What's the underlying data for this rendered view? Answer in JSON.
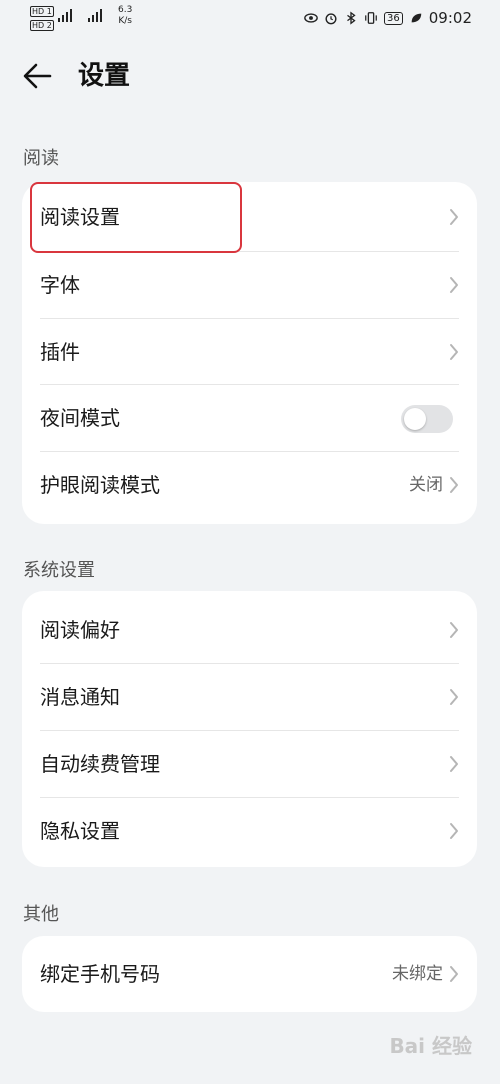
{
  "status": {
    "sim1": "HD 1",
    "sim2": "HD 2",
    "net_speed": "6.3",
    "net_unit": "K/s",
    "battery": "36",
    "time": "09:02",
    "icons": [
      "eye-icon",
      "alarm-icon",
      "bluetooth-icon",
      "vibrate-icon",
      "battery-icon",
      "leaf-icon"
    ]
  },
  "header": {
    "title": "设置",
    "back_icon": "back-arrow-icon"
  },
  "sections": {
    "reading": {
      "label": "阅读",
      "items": [
        {
          "label": "阅读设置",
          "type": "chevron"
        },
        {
          "label": "字体",
          "type": "chevron"
        },
        {
          "label": "插件",
          "type": "chevron"
        },
        {
          "label": "夜间模式",
          "type": "toggle",
          "on": false
        },
        {
          "label": "护眼阅读模式",
          "type": "chevron",
          "value": "关闭"
        }
      ]
    },
    "system": {
      "label": "系统设置",
      "items": [
        {
          "label": "阅读偏好",
          "type": "chevron"
        },
        {
          "label": "消息通知",
          "type": "chevron"
        },
        {
          "label": "自动续费管理",
          "type": "chevron"
        },
        {
          "label": "隐私设置",
          "type": "chevron"
        }
      ]
    },
    "other": {
      "label": "其他",
      "items": [
        {
          "label": "绑定手机号码",
          "type": "chevron",
          "value": "未绑定"
        }
      ]
    }
  },
  "watermark": "Bai 经验",
  "colors": {
    "background": "#f1f3f5",
    "card": "#ffffff",
    "highlight": "#d9363e",
    "toggle_off": "#e2e3e5"
  }
}
